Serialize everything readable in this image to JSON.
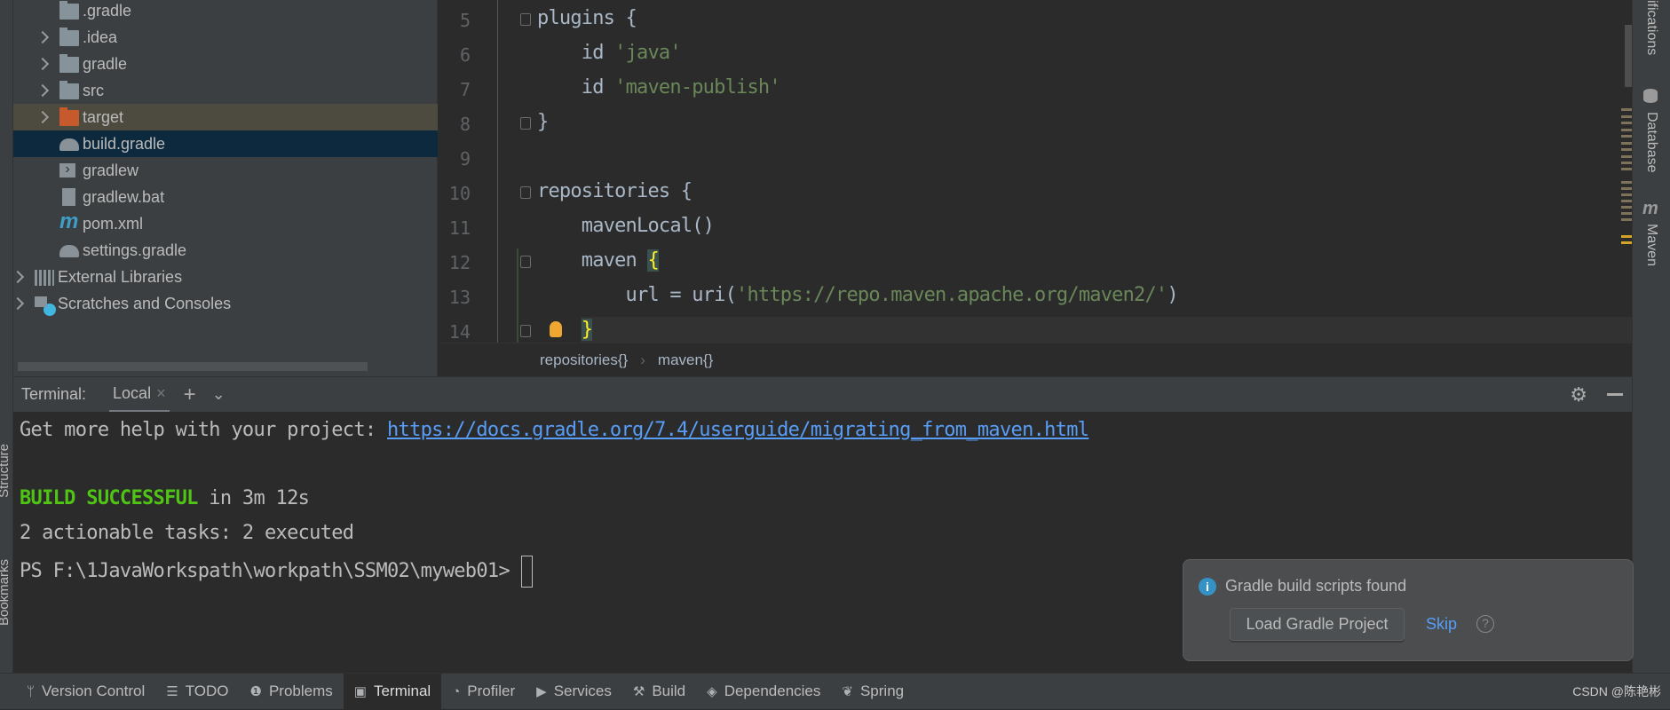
{
  "project_tree": [
    {
      "label": ".gradle",
      "icon": "folder-icon",
      "expandable": false
    },
    {
      "label": ".idea",
      "icon": "folder-icon",
      "expandable": true
    },
    {
      "label": "gradle",
      "icon": "folder-icon",
      "expandable": true
    },
    {
      "label": "src",
      "icon": "folder-icon",
      "expandable": true
    },
    {
      "label": "target",
      "icon": "excluded-folder-icon",
      "expandable": true,
      "state": "excluded"
    },
    {
      "label": "build.gradle",
      "icon": "gradle-elephant-icon",
      "state": "selected"
    },
    {
      "label": "gradlew",
      "icon": "shell-script-icon"
    },
    {
      "label": "gradlew.bat",
      "icon": "text-file-icon"
    },
    {
      "label": "pom.xml",
      "icon": "maven-icon"
    },
    {
      "label": "settings.gradle",
      "icon": "gradle-elephant-icon"
    },
    {
      "label": "External Libraries",
      "icon": "libraries-icon",
      "expandable": true
    },
    {
      "label": "Scratches and Consoles",
      "icon": "scratches-icon",
      "expandable": true
    }
  ],
  "editor": {
    "lines": [
      {
        "n": "5",
        "parts": [
          [
            "plugins {",
            ""
          ]
        ]
      },
      {
        "n": "6",
        "parts": [
          [
            "    id ",
            ""
          ],
          [
            "'java'",
            "str"
          ]
        ]
      },
      {
        "n": "7",
        "parts": [
          [
            "    id ",
            ""
          ],
          [
            "'maven-publish'",
            "str"
          ]
        ]
      },
      {
        "n": "8",
        "parts": [
          [
            "}",
            ""
          ]
        ]
      },
      {
        "n": "9",
        "parts": []
      },
      {
        "n": "10",
        "parts": [
          [
            "repositories {",
            ""
          ]
        ]
      },
      {
        "n": "11",
        "parts": [
          [
            "    mavenLocal()",
            ""
          ]
        ]
      },
      {
        "n": "12",
        "parts": [
          [
            "    maven ",
            ""
          ],
          [
            "{",
            "brace"
          ]
        ]
      },
      {
        "n": "13",
        "parts": [
          [
            "        url = uri(",
            ""
          ],
          [
            "'https://repo.maven.apache.org/maven2/'",
            "str"
          ],
          [
            ")",
            ""
          ]
        ]
      },
      {
        "n": "14",
        "parts": [
          [
            "    ",
            ""
          ],
          [
            "}",
            "brace"
          ]
        ]
      }
    ],
    "breadcrumb": [
      "repositories{}",
      "maven{}"
    ]
  },
  "right_stripe": [
    "ifications",
    "Database",
    "Maven"
  ],
  "left_stripe": [
    "Structure",
    "Bookmarks"
  ],
  "terminal": {
    "title": "Terminal:",
    "tab": "Local",
    "lines": {
      "help_prefix": "Get more help with your project: ",
      "help_link": "https://docs.gradle.org/7.4/userguide/migrating_from_maven.html",
      "build_status": "BUILD SUCCESSFUL",
      "build_time": " in 3m 12s",
      "tasks": "2 actionable tasks: 2 executed",
      "prompt": "PS F:\\1JavaWorkspath\\workpath\\SSM02\\myweb01> "
    }
  },
  "notification": {
    "message": "Gradle build scripts found",
    "primary_button": "Load Gradle Project",
    "link": "Skip"
  },
  "statusbar": {
    "items": [
      {
        "label": "Version Control",
        "icon": "branch-icon"
      },
      {
        "label": "TODO",
        "icon": "list-icon"
      },
      {
        "label": "Problems",
        "icon": "warning-icon"
      },
      {
        "label": "Terminal",
        "icon": "terminal-icon",
        "active": true
      },
      {
        "label": "Profiler",
        "icon": "profiler-icon"
      },
      {
        "label": "Services",
        "icon": "services-icon"
      },
      {
        "label": "Build",
        "icon": "hammer-icon"
      },
      {
        "label": "Dependencies",
        "icon": "dependencies-icon"
      },
      {
        "label": "Spring",
        "icon": "spring-leaf-icon"
      }
    ],
    "watermark": "CSDN @陈艳彬"
  },
  "colors": {
    "accent_link": "#589df6",
    "success": "#4fc414",
    "selection": "#0d293e",
    "string": "#6a8759"
  }
}
